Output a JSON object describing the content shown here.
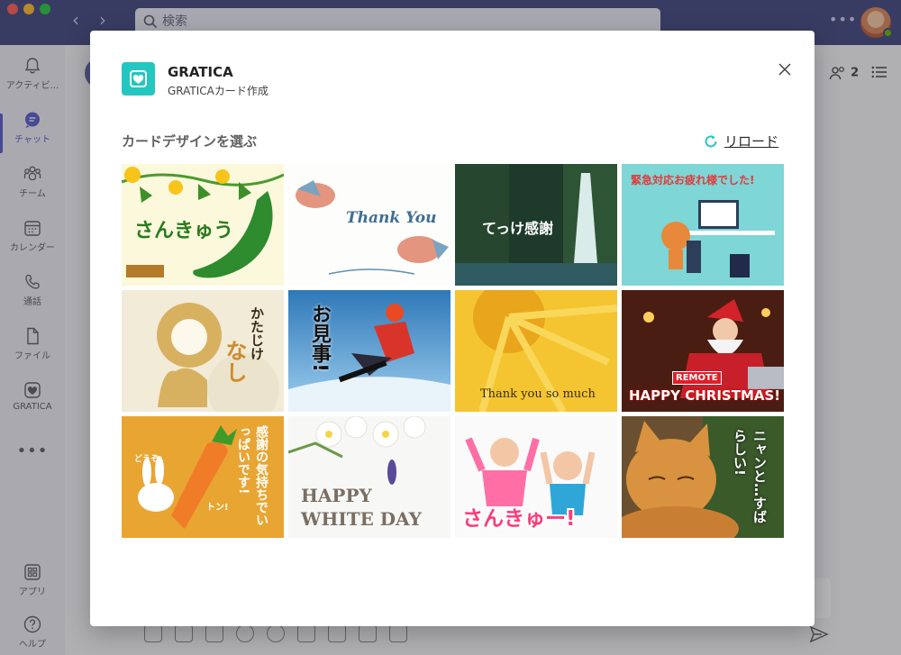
{
  "window": {
    "search_placeholder": "検索",
    "participant_count": "2"
  },
  "rail": {
    "items": [
      {
        "label": "アクティビ...",
        "icon": "bell-icon"
      },
      {
        "label": "チャット",
        "icon": "chat-icon"
      },
      {
        "label": "チーム",
        "icon": "teams-icon"
      },
      {
        "label": "カレンダー",
        "icon": "calendar-icon"
      },
      {
        "label": "通話",
        "icon": "phone-icon"
      },
      {
        "label": "ファイル",
        "icon": "file-icon"
      },
      {
        "label": "GRATICA",
        "icon": "gratica-heart-icon"
      },
      {
        "label": "アプリ",
        "icon": "apps-icon"
      },
      {
        "label": "ヘルプ",
        "icon": "help-icon"
      }
    ],
    "active_item": "チャット"
  },
  "modal": {
    "app_name": "GRATICA",
    "app_subtitle": "GRATICAカード作成",
    "section_title": "カードデザインを選ぶ",
    "reload_label": "リロード",
    "accent_color": "#24c6c0"
  },
  "cards": [
    {
      "id": "sankyu-cucumber",
      "text": "さんきゅう"
    },
    {
      "id": "thank-you-birds",
      "text": "Thank You"
    },
    {
      "id": "kokoro-kara-kansha-waterfall",
      "text": "てっけ感謝"
    },
    {
      "id": "kinkyu-taiou",
      "text": "緊急対応お疲れ様でした!"
    },
    {
      "id": "katajikenashi",
      "text_top": "かたじけ",
      "text_bottom": "なし"
    },
    {
      "id": "omigoto-snowboard",
      "text": "お見事!"
    },
    {
      "id": "sunflower-thank-you",
      "text": "Thank you so much"
    },
    {
      "id": "remote-christmas",
      "badge": "REMOTE",
      "text": "HAPPY CHRISTMAS!"
    },
    {
      "id": "carrot-rabbit",
      "text_small": "どうぞ",
      "text_vertical": "感謝の気持ちでいっぱいです!",
      "text_ton": "トン!"
    },
    {
      "id": "happy-white-day",
      "line1": "HAPPY",
      "line2": "WHITE DAY"
    },
    {
      "id": "sankyu-babies",
      "text": "さんきゅー!"
    },
    {
      "id": "nyanto-cat",
      "text": "ニャンと…すばらしい!"
    }
  ]
}
